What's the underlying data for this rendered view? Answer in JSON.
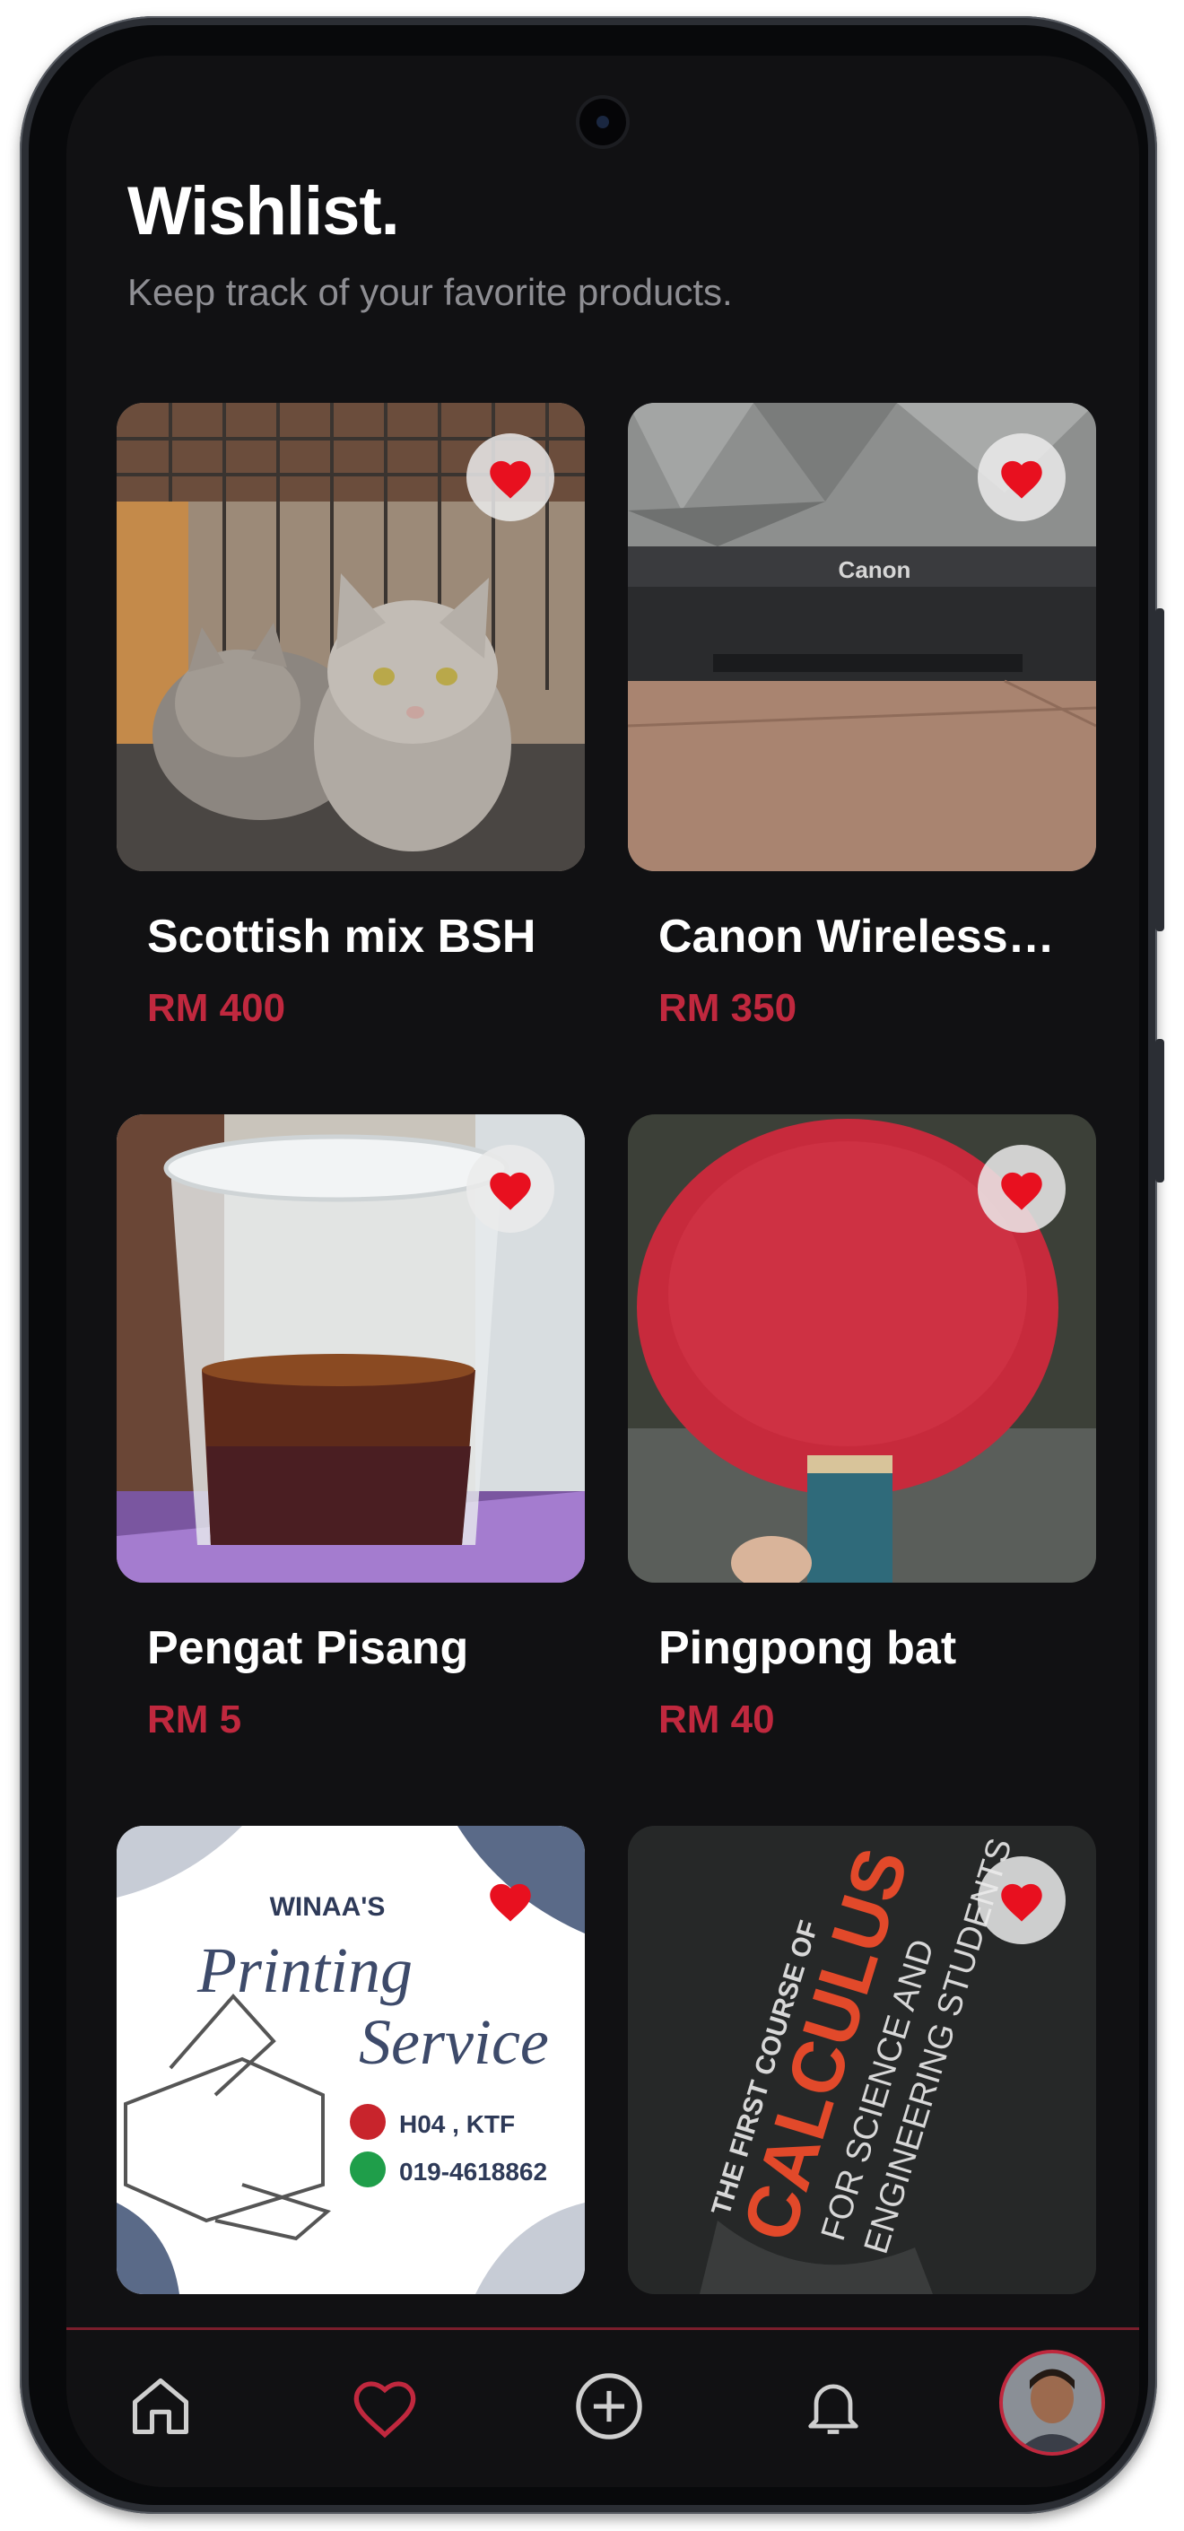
{
  "header": {
    "title": "Wishlist.",
    "subtitle": "Keep track of your favorite products."
  },
  "products": [
    {
      "name": "Scottish mix BSH",
      "price": "RM 400",
      "image": "kittens-photo"
    },
    {
      "name": "Canon Wireless…",
      "price": "RM 350",
      "image": "canon-printer-photo"
    },
    {
      "name": "Pengat Pisang",
      "price": "RM 5",
      "image": "dessert-cup-photo"
    },
    {
      "name": "Pingpong bat",
      "price": "RM 40",
      "image": "pingpong-bat-photo"
    },
    {
      "name": "",
      "price": "",
      "image": "printing-service-poster",
      "poster": {
        "brand": "WINAA'S",
        "line1": "Printing",
        "line2": "Service",
        "location": "H04 , KTF",
        "phone": "019-4618862"
      }
    },
    {
      "name": "",
      "price": "",
      "image": "calculus-book-photo",
      "book": {
        "line1": "THE FIRST COURSE OF",
        "line2": "CALCULUS",
        "line3": "FOR SCIENCE AND",
        "line4": "ENGINEERING STUDENTS"
      }
    }
  ],
  "bottom_nav": [
    "home-icon",
    "heart-icon",
    "add-icon",
    "bell-icon",
    "profile-avatar"
  ],
  "colors": {
    "accent": "#c0283e",
    "heart": "#e8101f",
    "background": "#111113"
  }
}
